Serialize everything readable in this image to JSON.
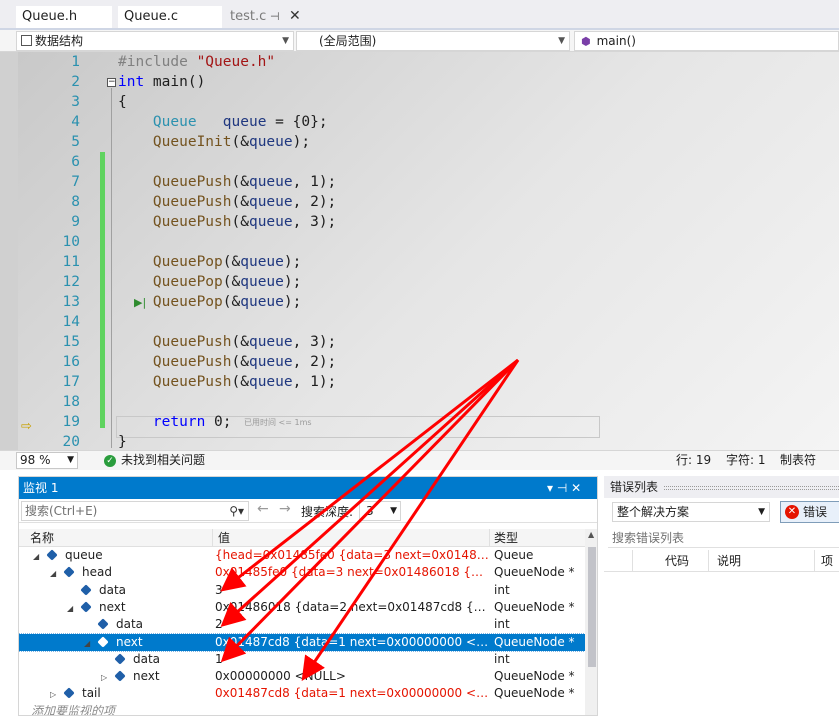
{
  "tabs": [
    {
      "label": "Queue.h"
    },
    {
      "label": "Queue.c"
    },
    {
      "label": "test.c"
    }
  ],
  "tab_pin_glyph": "⊣",
  "tab_close_glyph": "✕",
  "nav": {
    "project": "数据结构",
    "scope": "(全局范围)",
    "function": "main()"
  },
  "code_lines": [
    {
      "n": "1",
      "text": "#include \"Queue.h\""
    },
    {
      "n": "2",
      "text": "int main()"
    },
    {
      "n": "3",
      "text": "{"
    },
    {
      "n": "4",
      "text": "    Queue   queue = {0};"
    },
    {
      "n": "5",
      "text": "    QueueInit(&queue);"
    },
    {
      "n": "6",
      "text": ""
    },
    {
      "n": "7",
      "text": "    QueuePush(&queue, 1);"
    },
    {
      "n": "8",
      "text": "    QueuePush(&queue, 2);"
    },
    {
      "n": "9",
      "text": "    QueuePush(&queue, 3);"
    },
    {
      "n": "10",
      "text": ""
    },
    {
      "n": "11",
      "text": "    QueuePop(&queue);"
    },
    {
      "n": "12",
      "text": "    QueuePop(&queue);"
    },
    {
      "n": "13",
      "text": "    QueuePop(&queue);"
    },
    {
      "n": "14",
      "text": ""
    },
    {
      "n": "15",
      "text": "    QueuePush(&queue, 3);"
    },
    {
      "n": "16",
      "text": "    QueuePush(&queue, 2);"
    },
    {
      "n": "17",
      "text": "    QueuePush(&queue, 1);"
    },
    {
      "n": "18",
      "text": ""
    },
    {
      "n": "19",
      "text": "    return 0;"
    },
    {
      "n": "20",
      "text": "}"
    }
  ],
  "elapsed_hint": "已用时间 <= 1ms",
  "status": {
    "zoom": "98 %",
    "issues": "未找到相关问题",
    "line": "行: 19",
    "char": "字符: 1",
    "tab_mode": "制表符"
  },
  "watch": {
    "title": "监视 1",
    "title_controls": "▾ ⊣ ✕",
    "search_placeholder": "搜索(Ctrl+E)",
    "search_depth_label": "搜索深度:",
    "search_depth_value": "3",
    "columns": {
      "name": "名称",
      "value": "值",
      "type": "类型"
    },
    "rows": [
      {
        "name": "queue",
        "value": "{head=0x01485fe0 {data=3 next=0x01486018 {d...",
        "type": "Queue",
        "indent": 0,
        "expand": "open",
        "changed": true
      },
      {
        "name": "head",
        "value": "0x01485fe0 {data=3 next=0x01486018 {data=2 n...",
        "type": "QueueNode *",
        "indent": 1,
        "expand": "open",
        "changed": true
      },
      {
        "name": "data",
        "value": "3",
        "type": "int",
        "indent": 2,
        "expand": "none",
        "changed": false
      },
      {
        "name": "next",
        "value": "0x01486018 {data=2 next=0x01487cd8 {data=1 ...",
        "type": "QueueNode *",
        "indent": 2,
        "expand": "open",
        "changed": false
      },
      {
        "name": "data",
        "value": "2",
        "type": "int",
        "indent": 3,
        "expand": "none",
        "changed": false
      },
      {
        "name": "next",
        "value": "0x01487cd8 {data=1 next=0x00000000 <NULL> }",
        "type": "QueueNode *",
        "indent": 3,
        "expand": "open",
        "changed": false,
        "selected": true
      },
      {
        "name": "data",
        "value": "1",
        "type": "int",
        "indent": 4,
        "expand": "none",
        "changed": false
      },
      {
        "name": "next",
        "value": "0x00000000 <NULL>",
        "type": "QueueNode *",
        "indent": 4,
        "expand": "closed",
        "changed": false
      },
      {
        "name": "tail",
        "value": "0x01487cd8 {data=1 next=0x00000000 <NULL> }",
        "type": "QueueNode *",
        "indent": 1,
        "expand": "closed",
        "changed": true
      }
    ],
    "add_item": "添加要监视的项"
  },
  "errors": {
    "title": "错误列表",
    "scope": "整个解决方案",
    "errors_button": "错误",
    "search_placeholder": "搜索错误列表",
    "columns": {
      "code": "代码",
      "desc": "说明",
      "item": "项"
    }
  },
  "colors": {
    "accent": "#007acc",
    "changed_value": "#e51400",
    "annotation_arrow": "#ff0000"
  }
}
